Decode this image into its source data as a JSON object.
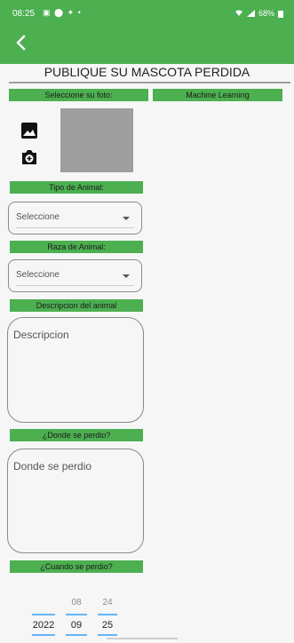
{
  "status_bar": {
    "time": "08:25",
    "left_icons": "▣ ⬤ ✦ •",
    "battery": "68%"
  },
  "header": {
    "title": "PUBLIQUE SU MASCOTA PERDIDA"
  },
  "photo_section": {
    "label": "Seleccione su foto:",
    "ml_label": "Machine Learning"
  },
  "animal_type": {
    "label": "Tipo de Animal:",
    "value": "Seleccione"
  },
  "animal_breed": {
    "label": "Raza de Animal:",
    "value": "Seleccione"
  },
  "description": {
    "label": "Descripcion del animal",
    "placeholder": "Descripcion"
  },
  "where_lost": {
    "label": "¿Donde se perdio?",
    "placeholder": "Donde se perdio"
  },
  "when_lost": {
    "label": "¿Cuando se perdio?",
    "date": {
      "year": {
        "above": "",
        "value": "2022"
      },
      "month": {
        "above": "08",
        "value": "09"
      },
      "day": {
        "above": "24",
        "value": "25"
      }
    }
  },
  "colors": {
    "accent": "#4caf50",
    "picker": "#64b5f6"
  }
}
